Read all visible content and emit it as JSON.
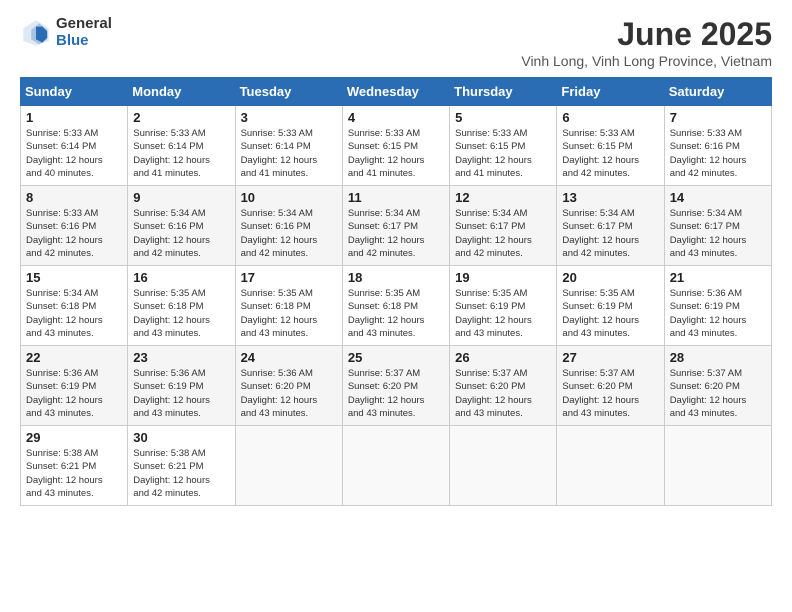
{
  "logo": {
    "general": "General",
    "blue": "Blue"
  },
  "header": {
    "month_title": "June 2025",
    "location": "Vinh Long, Vinh Long Province, Vietnam"
  },
  "weekdays": [
    "Sunday",
    "Monday",
    "Tuesday",
    "Wednesday",
    "Thursday",
    "Friday",
    "Saturday"
  ],
  "weeks": [
    [
      {
        "day": "1",
        "info": "Sunrise: 5:33 AM\nSunset: 6:14 PM\nDaylight: 12 hours\nand 40 minutes."
      },
      {
        "day": "2",
        "info": "Sunrise: 5:33 AM\nSunset: 6:14 PM\nDaylight: 12 hours\nand 41 minutes."
      },
      {
        "day": "3",
        "info": "Sunrise: 5:33 AM\nSunset: 6:14 PM\nDaylight: 12 hours\nand 41 minutes."
      },
      {
        "day": "4",
        "info": "Sunrise: 5:33 AM\nSunset: 6:15 PM\nDaylight: 12 hours\nand 41 minutes."
      },
      {
        "day": "5",
        "info": "Sunrise: 5:33 AM\nSunset: 6:15 PM\nDaylight: 12 hours\nand 41 minutes."
      },
      {
        "day": "6",
        "info": "Sunrise: 5:33 AM\nSunset: 6:15 PM\nDaylight: 12 hours\nand 42 minutes."
      },
      {
        "day": "7",
        "info": "Sunrise: 5:33 AM\nSunset: 6:16 PM\nDaylight: 12 hours\nand 42 minutes."
      }
    ],
    [
      {
        "day": "8",
        "info": "Sunrise: 5:33 AM\nSunset: 6:16 PM\nDaylight: 12 hours\nand 42 minutes."
      },
      {
        "day": "9",
        "info": "Sunrise: 5:34 AM\nSunset: 6:16 PM\nDaylight: 12 hours\nand 42 minutes."
      },
      {
        "day": "10",
        "info": "Sunrise: 5:34 AM\nSunset: 6:16 PM\nDaylight: 12 hours\nand 42 minutes."
      },
      {
        "day": "11",
        "info": "Sunrise: 5:34 AM\nSunset: 6:17 PM\nDaylight: 12 hours\nand 42 minutes."
      },
      {
        "day": "12",
        "info": "Sunrise: 5:34 AM\nSunset: 6:17 PM\nDaylight: 12 hours\nand 42 minutes."
      },
      {
        "day": "13",
        "info": "Sunrise: 5:34 AM\nSunset: 6:17 PM\nDaylight: 12 hours\nand 42 minutes."
      },
      {
        "day": "14",
        "info": "Sunrise: 5:34 AM\nSunset: 6:17 PM\nDaylight: 12 hours\nand 43 minutes."
      }
    ],
    [
      {
        "day": "15",
        "info": "Sunrise: 5:34 AM\nSunset: 6:18 PM\nDaylight: 12 hours\nand 43 minutes."
      },
      {
        "day": "16",
        "info": "Sunrise: 5:35 AM\nSunset: 6:18 PM\nDaylight: 12 hours\nand 43 minutes."
      },
      {
        "day": "17",
        "info": "Sunrise: 5:35 AM\nSunset: 6:18 PM\nDaylight: 12 hours\nand 43 minutes."
      },
      {
        "day": "18",
        "info": "Sunrise: 5:35 AM\nSunset: 6:18 PM\nDaylight: 12 hours\nand 43 minutes."
      },
      {
        "day": "19",
        "info": "Sunrise: 5:35 AM\nSunset: 6:19 PM\nDaylight: 12 hours\nand 43 minutes."
      },
      {
        "day": "20",
        "info": "Sunrise: 5:35 AM\nSunset: 6:19 PM\nDaylight: 12 hours\nand 43 minutes."
      },
      {
        "day": "21",
        "info": "Sunrise: 5:36 AM\nSunset: 6:19 PM\nDaylight: 12 hours\nand 43 minutes."
      }
    ],
    [
      {
        "day": "22",
        "info": "Sunrise: 5:36 AM\nSunset: 6:19 PM\nDaylight: 12 hours\nand 43 minutes."
      },
      {
        "day": "23",
        "info": "Sunrise: 5:36 AM\nSunset: 6:19 PM\nDaylight: 12 hours\nand 43 minutes."
      },
      {
        "day": "24",
        "info": "Sunrise: 5:36 AM\nSunset: 6:20 PM\nDaylight: 12 hours\nand 43 minutes."
      },
      {
        "day": "25",
        "info": "Sunrise: 5:37 AM\nSunset: 6:20 PM\nDaylight: 12 hours\nand 43 minutes."
      },
      {
        "day": "26",
        "info": "Sunrise: 5:37 AM\nSunset: 6:20 PM\nDaylight: 12 hours\nand 43 minutes."
      },
      {
        "day": "27",
        "info": "Sunrise: 5:37 AM\nSunset: 6:20 PM\nDaylight: 12 hours\nand 43 minutes."
      },
      {
        "day": "28",
        "info": "Sunrise: 5:37 AM\nSunset: 6:20 PM\nDaylight: 12 hours\nand 43 minutes."
      }
    ],
    [
      {
        "day": "29",
        "info": "Sunrise: 5:38 AM\nSunset: 6:21 PM\nDaylight: 12 hours\nand 43 minutes."
      },
      {
        "day": "30",
        "info": "Sunrise: 5:38 AM\nSunset: 6:21 PM\nDaylight: 12 hours\nand 42 minutes."
      },
      {
        "day": "",
        "info": ""
      },
      {
        "day": "",
        "info": ""
      },
      {
        "day": "",
        "info": ""
      },
      {
        "day": "",
        "info": ""
      },
      {
        "day": "",
        "info": ""
      }
    ]
  ]
}
